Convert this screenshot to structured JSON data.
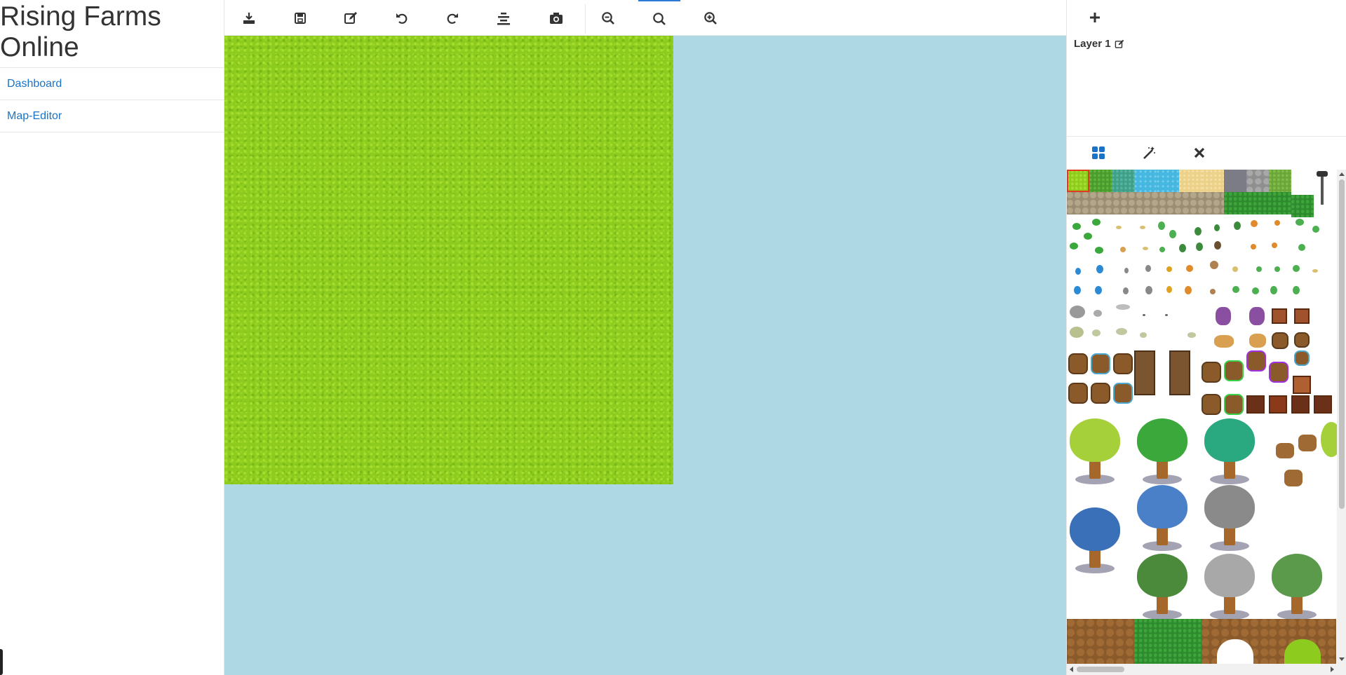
{
  "app": {
    "title": "Rising Farms Online"
  },
  "sidebar": {
    "items": [
      {
        "label": "Dashboard"
      },
      {
        "label": "Map-Editor"
      }
    ]
  },
  "toolbar": {
    "tools": [
      {
        "name": "export",
        "icon": "download-icon"
      },
      {
        "name": "save",
        "icon": "floppy-disk-icon"
      },
      {
        "name": "edit",
        "icon": "edit-icon"
      },
      {
        "name": "undo",
        "icon": "undo-icon"
      },
      {
        "name": "redo",
        "icon": "redo-icon"
      },
      {
        "name": "align",
        "icon": "align-center-icon"
      },
      {
        "name": "screenshot",
        "icon": "camera-icon"
      },
      {
        "name": "zoom-out",
        "icon": "zoom-out-icon"
      },
      {
        "name": "zoom-reset",
        "icon": "search-icon",
        "active": true
      },
      {
        "name": "zoom-in",
        "icon": "zoom-in-icon"
      }
    ]
  },
  "layers": {
    "add_icon": "plus-icon",
    "items": [
      {
        "label": "Layer 1",
        "icon": "edit-icon"
      }
    ]
  },
  "palette": {
    "tabs": [
      {
        "icon": "grid-icon",
        "active": true
      },
      {
        "icon": "magic-wand-icon"
      },
      {
        "icon": "close-icon"
      }
    ]
  },
  "colors": {
    "accent": "#1a73c8",
    "canvas_bg": "#add8e4",
    "grass": "#8dcc1e",
    "selection": "#e03b1f"
  }
}
